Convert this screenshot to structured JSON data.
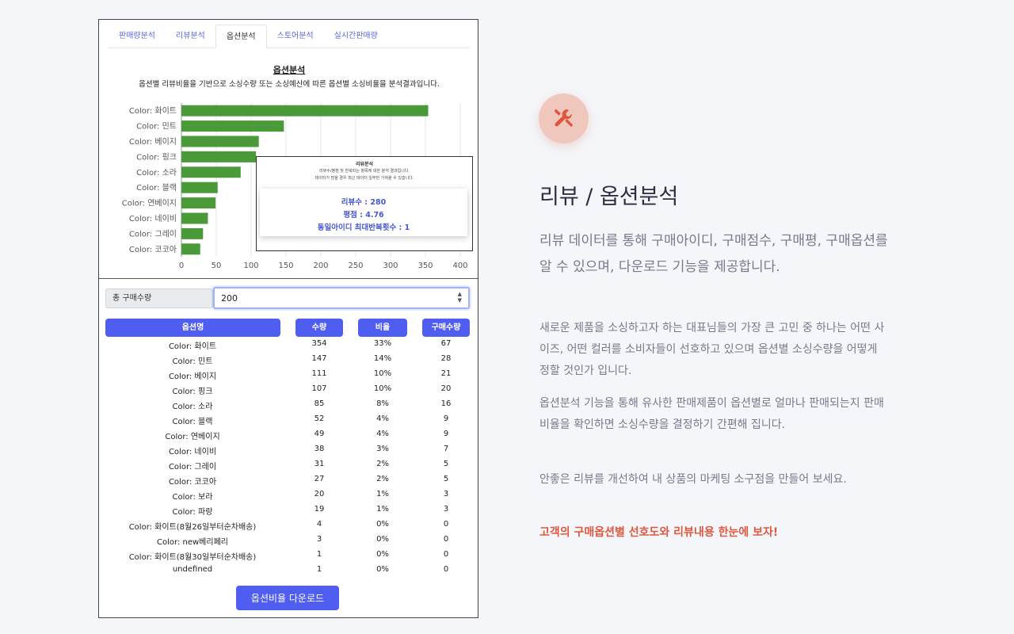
{
  "tabs": [
    {
      "label": "판매량분석"
    },
    {
      "label": "리뷰분석"
    },
    {
      "label": "옵션분석"
    },
    {
      "label": "스토어분석"
    },
    {
      "label": "실시간판매량"
    }
  ],
  "analysis": {
    "title": "옵션분석",
    "subtitle": "옵션별 리뷰비율을 기반으로 소싱수량 또는 소싱예산에 따른 옵션별 소싱비율을 분석결과입니다."
  },
  "chart_data": {
    "type": "bar",
    "orientation": "horizontal",
    "categories": [
      "Color: 화이트",
      "Color: 민트",
      "Color: 베이지",
      "Color: 핑크",
      "Color: 소라",
      "Color: 블랙",
      "Color: 연베이지",
      "Color: 네이비",
      "Color: 그레이",
      "Color: 코코아"
    ],
    "values": [
      354,
      147,
      111,
      107,
      85,
      52,
      49,
      38,
      31,
      27
    ],
    "xticks": [
      0,
      50,
      100,
      150,
      200,
      250,
      300,
      350,
      400
    ],
    "xlim": [
      0,
      400
    ],
    "grid": true,
    "bar_color": "#4b9a3a"
  },
  "tooltip": {
    "title": "리뷰분석",
    "line1": "리뷰수/평점 및 반복되는 항목에 대한 분석 결과입니다.",
    "line2": "데이터가 많을 경우 최근 데이터 일부만 가져올 수 있습니다.",
    "reviews": "리뷰수 : 280",
    "rating": "평점 : 4.76",
    "repeat": "동일아이디 최대반복횟수 : 1"
  },
  "quantity": {
    "label": "총 구매수량",
    "value": "200"
  },
  "table": {
    "headers": [
      "옵션명",
      "수량",
      "비율",
      "구매수량"
    ],
    "rows": [
      [
        "Color: 화이트",
        "354",
        "33%",
        "67"
      ],
      [
        "Color: 민트",
        "147",
        "14%",
        "28"
      ],
      [
        "Color: 베이지",
        "111",
        "10%",
        "21"
      ],
      [
        "Color: 핑크",
        "107",
        "10%",
        "20"
      ],
      [
        "Color: 소라",
        "85",
        "8%",
        "16"
      ],
      [
        "Color: 블랙",
        "52",
        "4%",
        "9"
      ],
      [
        "Color: 연베이지",
        "49",
        "4%",
        "9"
      ],
      [
        "Color: 네이비",
        "38",
        "3%",
        "7"
      ],
      [
        "Color: 그레이",
        "31",
        "2%",
        "5"
      ],
      [
        "Color: 코코아",
        "27",
        "2%",
        "5"
      ],
      [
        "Color: 보라",
        "20",
        "1%",
        "3"
      ],
      [
        "Color: 파랑",
        "19",
        "1%",
        "3"
      ],
      [
        "Color: 화이트(8월26일부터순차배송)",
        "4",
        "0%",
        "0"
      ],
      [
        "Color: new베리페리",
        "3",
        "0%",
        "0"
      ],
      [
        "Color: 화이트(8월30일부터순차배송)",
        "1",
        "0%",
        "0"
      ],
      [
        "undefined",
        "1",
        "0%",
        "0"
      ]
    ]
  },
  "download_label": "옵션비율 다운로드",
  "feature": {
    "icon": "tools-icon",
    "accent_color": "#e0573f",
    "title": "리뷰 / 옵션분석",
    "lead": "리뷰 데이터를 통해 구매아이디, 구매점수, 구매평, 구매옵션를 알 수 있으며, 다운로드 기능을 제공합니다.",
    "para1": "새로운 제품을 소싱하고자 하는 대표님들의 가장 큰 고민 중 하나는 어떤 사이즈, 어떤 컬러를 소비자들이 선호하고 있으며 옵션별 소싱수량을 어떻게 정할 것인가 입니다.",
    "para2": "옵션분석 기능을 통해 유사한 판매제품이 옵션별로 얼마나 판매되는지 판매비율을 확인하면 소싱수량을 결정하기 간편해 집니다.",
    "para3": "안좋은 리뷰를 개선하여 내 상품의 마케팅 소구점을 만들어 보세요.",
    "accent": "고객의 구매옵션별 선호도와 리뷰내용 한눈에 보자!"
  }
}
